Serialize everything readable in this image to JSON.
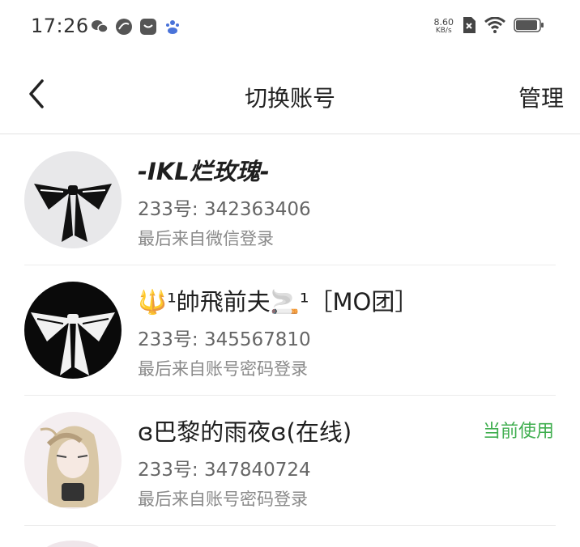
{
  "status_bar": {
    "time": "17:26",
    "net_speed_value": "8.60",
    "net_speed_unit": "KB/s",
    "icons": [
      "wechat-icon",
      "swirl-app-icon",
      "mail-app-icon",
      "baidu-icon",
      "sim-off-icon",
      "wifi-icon",
      "battery-icon"
    ]
  },
  "header": {
    "title": "切换账号",
    "manage_label": "管理"
  },
  "accounts": [
    {
      "name": "-IKL烂玫瑰-",
      "id_line": "233号: 342363406",
      "login_source": "最后来自微信登录",
      "avatar": "bow-avatar-light",
      "current": ""
    },
    {
      "name": "🔱¹帥飛前夫🚬¹［MO团］",
      "id_line": "233号: 345567810",
      "login_source": "最后来自账号密码登录",
      "avatar": "bow-avatar-dark",
      "current": ""
    },
    {
      "name": "ɞ巴黎的雨夜ɞ(在线)",
      "id_line": "233号: 347840724",
      "login_source": "最后来自账号密码登录",
      "avatar": "anime-girl-avatar",
      "current": "当前使用"
    }
  ],
  "colors": {
    "accent_green": "#3fae4f",
    "text_primary": "#1f1f1f",
    "text_secondary": "#8a8a8a"
  }
}
